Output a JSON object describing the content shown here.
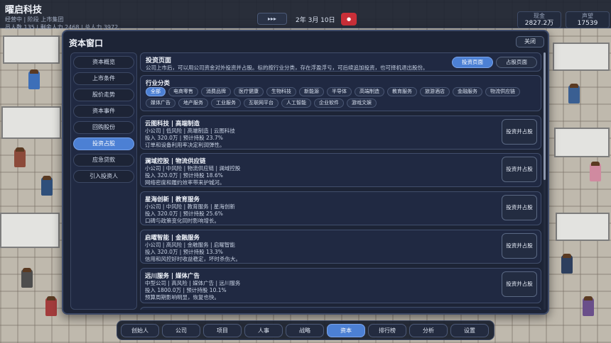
{
  "topbar": {
    "company_name": "曜启科技",
    "company_sub1": "经营中 | 阶段 上市集团",
    "company_sub2": "员人数 135 | 剩余人力 2468 | 总人力 3972",
    "speed": "▸▸▸",
    "date": "2年 3月 10日",
    "record": "●",
    "cash_label": "现金",
    "cash_value": "2827.2万",
    "rep_label": "声望",
    "rep_value": "17539"
  },
  "panel": {
    "title": "资本窗口",
    "close": "关闭"
  },
  "sidebar": {
    "items": [
      "资本概览",
      "上市条件",
      "股价走势",
      "资本事件",
      "回购股份",
      "投资占股",
      "应急贷款",
      "引入投资人"
    ],
    "active_index": 5
  },
  "header": {
    "title": "投资页面",
    "desc": "公司上市后，可以用公司资金对外投资并占股。标的按行业分类，存在浮盈浮亏，可后续追加投资，也可择机退出股份。",
    "btn_invest": "投资页面",
    "btn_holdings": "占股页面"
  },
  "industries": {
    "title": "行业分类",
    "items": [
      "全部",
      "电商零售",
      "消费品牌",
      "医疗健康",
      "生物科技",
      "新能源",
      "半导体",
      "高端制造",
      "教育服务",
      "旅游酒店",
      "金融服务",
      "物流供应链",
      "媒体广告",
      "地产服务",
      "工业服务",
      "互联网平台",
      "人工智能",
      "企业软件",
      "游戏文娱"
    ],
    "active_index": 0
  },
  "companies": [
    {
      "title": "云图科技 | 高端制造",
      "line1": "小公司 | 低风险 | 高端制造 | 云图科技",
      "line2": "投入 320.0万 | 预计持股 23.7%",
      "line3": "订单和设备利用率决定利润弹性。",
      "button": "投资并占股"
    },
    {
      "title": "澜域控股 | 物流供应链",
      "line1": "小公司 | 中风险 | 物流供应链 | 澜域控股",
      "line2": "投入 320.0万 | 预计持股 18.6%",
      "line3": "网络密度和履约效率带来护城河。",
      "button": "投资并占股"
    },
    {
      "title": "星海创新 | 教育服务",
      "line1": "小公司 | 中风险 | 教育服务 | 星海创新",
      "line2": "投入 320.0万 | 预计持股 25.6%",
      "line3": "口碑与政策变化同时影响增长。",
      "button": "投资并占股"
    },
    {
      "title": "启曜智能 | 金融服务",
      "line1": "小公司 | 高风险 | 金融服务 | 启曜智能",
      "line2": "投入 320.0万 | 预计持股 13.3%",
      "line3": "信用和风控好时收益稳定，坏时杀伤大。",
      "button": "投资并占股"
    },
    {
      "title": "远川服务 | 媒体广告",
      "line1": "中型公司 | 高风险 | 媒体广告 | 远川服务",
      "line2": "投入 1800.0万 | 预计持股 10.1%",
      "line3": "预算周期影响明显，恢复也快。",
      "button": "投资并占股"
    }
  ],
  "bottom_nav": {
    "items": [
      "创始人",
      "公司",
      "项目",
      "人事",
      "战略",
      "资本",
      "排行榜",
      "分析",
      "设置"
    ],
    "active_index": 5
  }
}
